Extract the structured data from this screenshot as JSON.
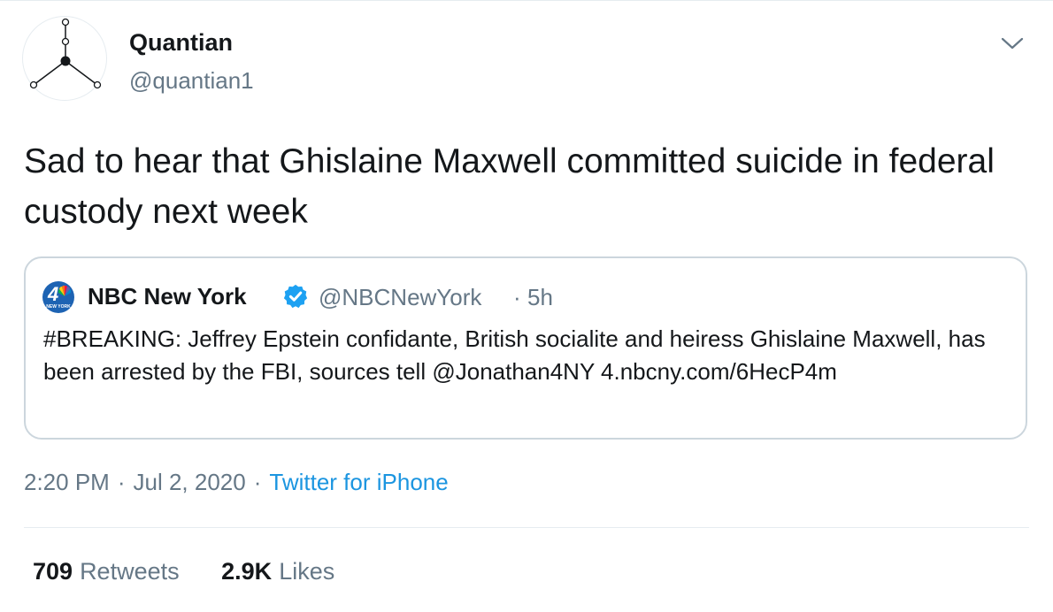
{
  "author": {
    "display_name": "Quantian",
    "handle": "@quantian1",
    "avatar_icon": "node-graph-icon"
  },
  "tweet": {
    "text": "Sad to hear that Ghislaine Maxwell committed suicide in federal custody next week"
  },
  "quoted_tweet": {
    "avatar_number": "4",
    "avatar_caption": "NEW YORK",
    "display_name": "NBC New York",
    "verified": true,
    "handle": "@NBCNewYork",
    "separator": "·",
    "time_ago": "5h",
    "text": "#BREAKING: Jeffrey Epstein confidante, British socialite and heiress Ghislaine Maxwell, has been arrested by the FBI, sources tell @Jonathan4NY 4.nbcny.com/6HecP4m"
  },
  "meta": {
    "time": "2:20 PM",
    "separator": "·",
    "date": "Jul 2, 2020",
    "source": "Twitter for iPhone"
  },
  "stats": {
    "retweets_count": "709",
    "retweets_label": "Retweets",
    "likes_count": "2.9K",
    "likes_label": "Likes"
  },
  "colors": {
    "text_primary": "#14171a",
    "text_secondary": "#657786",
    "link": "#1b95e0",
    "verified": "#1da1f2",
    "border": "#ccd6dd"
  }
}
